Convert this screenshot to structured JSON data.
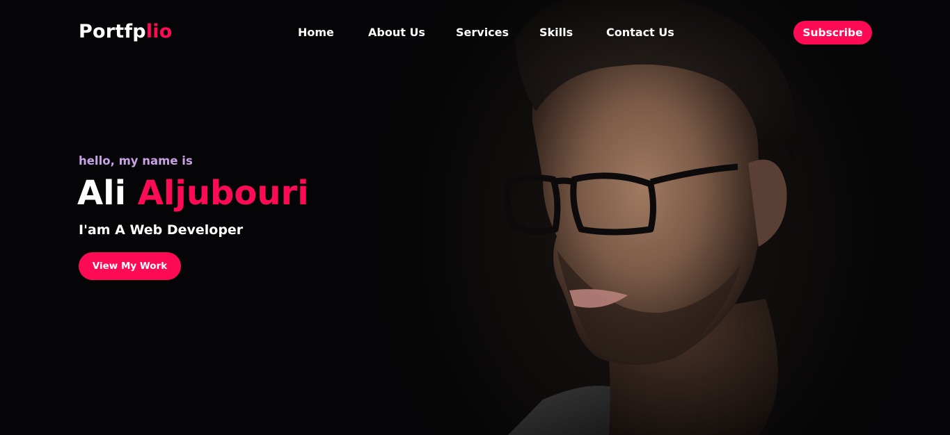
{
  "brand": {
    "name_main": "Portfp",
    "name_accent": "lio"
  },
  "nav": {
    "items": [
      {
        "label": "Home"
      },
      {
        "label": "About Us"
      },
      {
        "label": "Services"
      },
      {
        "label": "Skills"
      },
      {
        "label": "Contact Us"
      }
    ],
    "subscribe_label": "Subscribe"
  },
  "hero": {
    "greeting": "hello, my name is",
    "first_name": "Ali",
    "last_name": "Aljubouri",
    "role": "I'am A Web Developer",
    "cta_label": "View My Work"
  },
  "colors": {
    "accent": "#ff0a54",
    "greeting": "#c9a2e6",
    "background": "#050507"
  }
}
